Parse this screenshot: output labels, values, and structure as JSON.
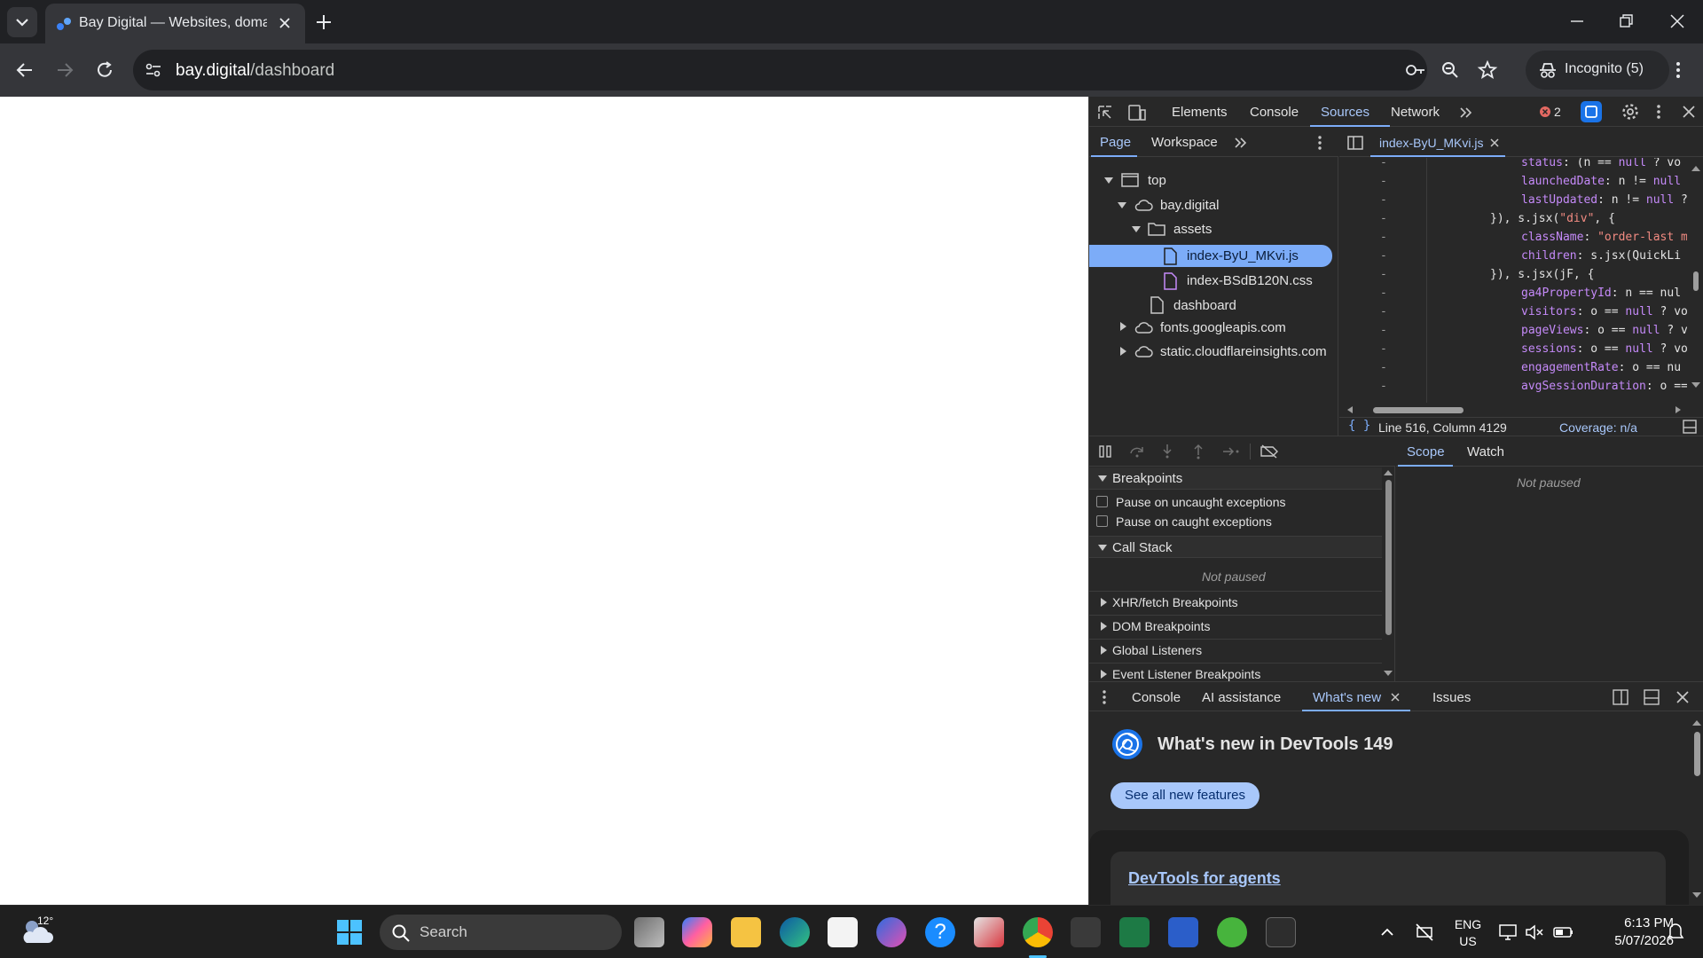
{
  "browser": {
    "tab_title": "Bay Digital — Websites, domain",
    "url_host": "bay.digital",
    "url_path": "/dashboard",
    "incognito_label": "Incognito (5)"
  },
  "devtools": {
    "main_tabs": [
      "Elements",
      "Console",
      "Sources",
      "Network"
    ],
    "active_main_tab": "Sources",
    "error_count": "2",
    "nav_tabs": [
      "Page",
      "Workspace"
    ],
    "tree": {
      "top": "top",
      "domain": "bay.digital",
      "folder": "assets",
      "file_js": "index-ByU_MKvi.js",
      "file_css": "index-BSdB120N.css",
      "dashboard": "dashboard",
      "fonts": "fonts.googleapis.com",
      "cloudflare": "static.cloudflareinsights.com"
    },
    "editor_tab": "index-ByU_MKvi.js",
    "code_lines": [
      "status: (n == null ? vo",
      "launchedDate: n != null",
      "lastUpdated: n != null ?",
      "}), s.jsx(\"div\", {",
      "className: \"order-last m",
      "children: s.jsx(QuickLi",
      "}), s.jsx(jF, {",
      "ga4PropertyId: n == nul",
      "visitors: o == null ? vo",
      "pageViews: o == null ? v",
      "sessions: o == null ? vo",
      "engagementRate: o == nu",
      "avgSessionDuration: o =="
    ],
    "status_position": "Line 516, Column 4129",
    "coverage": "Coverage: n/a",
    "scope_tabs": [
      "Scope",
      "Watch"
    ],
    "scope_not_paused": "Not paused",
    "breakpoints_title": "Breakpoints",
    "pause_uncaught": "Pause on uncaught exceptions",
    "pause_caught": "Pause on caught exceptions",
    "call_stack_title": "Call Stack",
    "call_stack_not_paused": "Not paused",
    "sections": [
      "XHR/fetch Breakpoints",
      "DOM Breakpoints",
      "Global Listeners",
      "Event Listener Breakpoints"
    ],
    "drawer_tabs": [
      "Console",
      "AI assistance",
      "What's new",
      "Issues"
    ],
    "whats_new_title": "What's new in DevTools 149",
    "see_all_button": "See all new features",
    "link_card": "DevTools for agents"
  },
  "taskbar": {
    "weather_temp": "12°",
    "search_placeholder": "Search",
    "lang_top": "ENG",
    "lang_bottom": "US",
    "time": "6:13 PM",
    "date": "5/07/2026"
  },
  "colors": {
    "accent": "#7cacf8",
    "devtools_bg": "#282828",
    "page_bg": "#ffffff"
  }
}
